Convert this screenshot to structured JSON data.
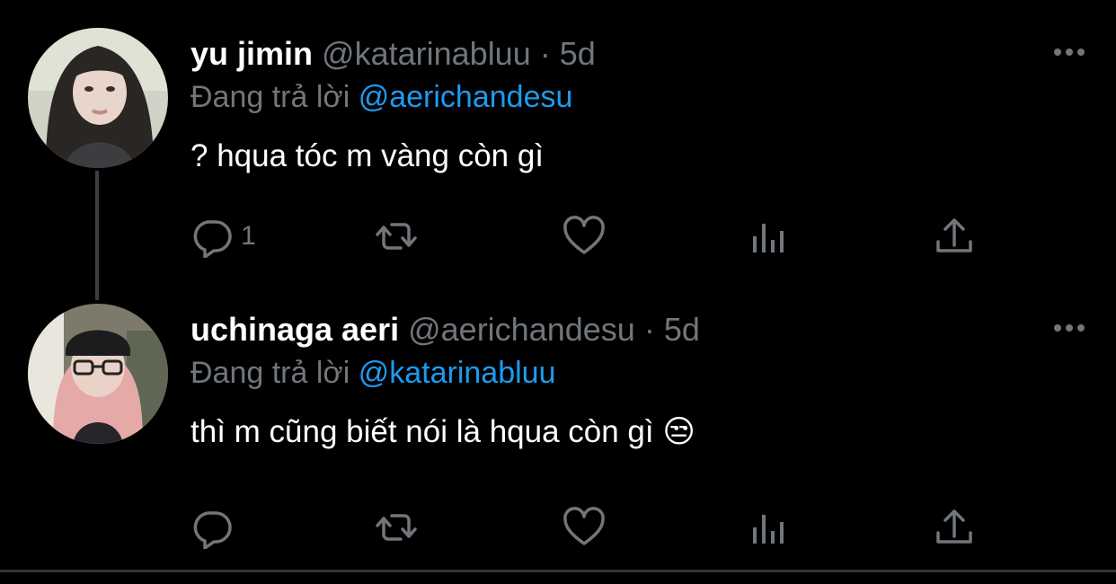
{
  "tweets": [
    {
      "name": "yu jimin",
      "handle": "@katarinabluu",
      "dot": "·",
      "time": "5d",
      "replying_prefix": "Đang trả lời",
      "replying_to": "@aerichandesu",
      "text": "? hqua tóc m vàng còn gì",
      "reply_count": "1",
      "avatar": "woman-dark-hair-avatar"
    },
    {
      "name": "uchinaga aeri",
      "handle": "@aerichandesu",
      "dot": "·",
      "time": "5d",
      "replying_prefix": "Đang trả lời",
      "replying_to": "@katarinabluu",
      "text": "thì m cũng biết nói là hqua còn gì",
      "emoji": "😒",
      "reply_count": "",
      "avatar": "woman-pink-hair-beanie-avatar"
    }
  ],
  "colors": {
    "background": "#000000",
    "name": "#ffffff",
    "secondary": "#71767b",
    "mention": "#1d9bf0"
  },
  "icons": [
    "reply-icon",
    "retweet-icon",
    "like-icon",
    "views-icon",
    "share-icon",
    "more-icon"
  ]
}
